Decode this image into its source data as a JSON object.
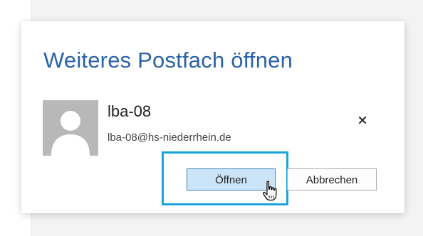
{
  "dialog": {
    "title": "Weiteres Postfach öffnen",
    "user": {
      "name": "lba-08",
      "email": "lba-08@hs-niederrhein.de"
    },
    "buttons": {
      "open_label": "Öffnen",
      "cancel_label": "Abbrechen"
    }
  },
  "icons": {
    "avatar": "person-placeholder-icon",
    "remove": "close-icon",
    "cursor": "hand-pointer-icon"
  },
  "colors": {
    "title": "#2a62a8",
    "highlight": "#1aa3db",
    "primary_button_bg": "#cce4f7",
    "primary_button_border": "#3c7fb1",
    "avatar_bg": "#b8b8b8"
  }
}
